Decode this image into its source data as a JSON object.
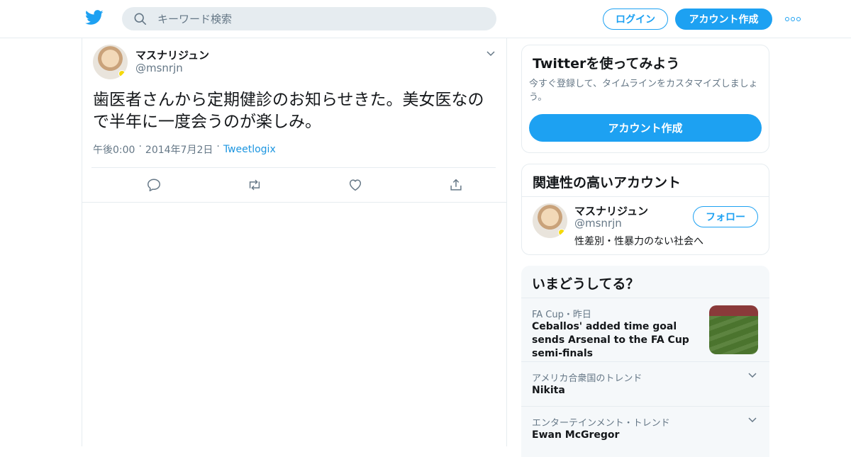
{
  "header": {
    "search_placeholder": "キーワード検索",
    "login_label": "ログイン",
    "signup_label": "アカウント作成"
  },
  "tweet": {
    "author_name": "マスナリジュン",
    "author_handle": "@msnrjn",
    "text": "歯医者さんから定期健診のお知らせきた。美女医なので半年に一度会うのが楽しみ。",
    "time": "午後0:00",
    "date": "2014年7月2日",
    "source": "Tweetlogix",
    "separator": "·"
  },
  "signup_card": {
    "title": "Twitterを使ってみよう",
    "description": "今すぐ登録して、タイムラインをカスタマイズしましょう。",
    "button_label": "アカウント作成"
  },
  "related_card": {
    "title": "関連性の高いアカウント",
    "account": {
      "name": "マスナリジュン",
      "handle": "@msnrjn",
      "bio": "性差別・性暴力のない社会へ",
      "follow_label": "フォロー"
    }
  },
  "trends_card": {
    "title": "いまどうしてる？",
    "items": [
      {
        "category": "FA Cup・昨日",
        "title": "Ceballos' added time goal sends Arsenal to the FA Cup semi-finals"
      },
      {
        "category": "アメリカ合衆国のトレンド",
        "title": "Nikita"
      },
      {
        "category": "エンターテインメント・トレンド",
        "title": "Ewan McGregor"
      }
    ]
  },
  "colors": {
    "accent": "#1da1f2",
    "text": "#14171a",
    "secondary": "#657786",
    "border": "#e6ecf0"
  }
}
